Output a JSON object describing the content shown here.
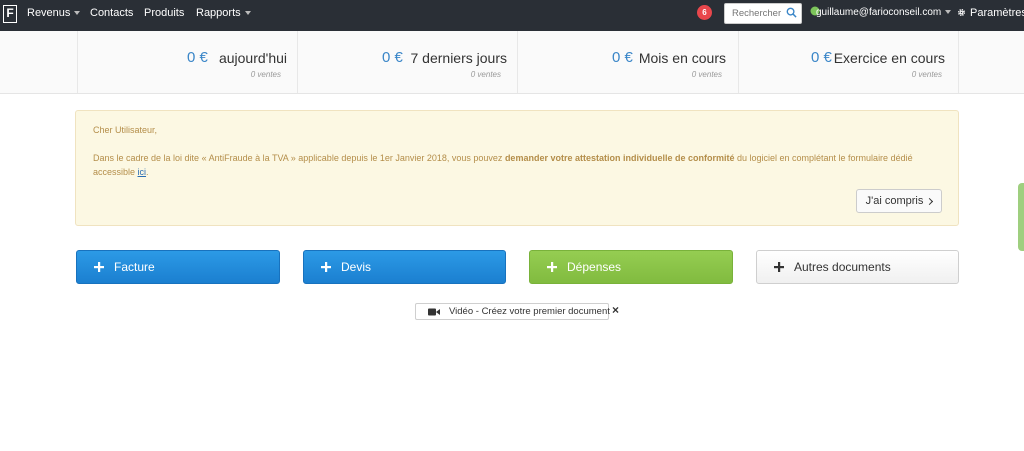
{
  "navbar": {
    "logo": "F",
    "menu": [
      {
        "label": "Revenus",
        "dropdown": true
      },
      {
        "label": "Contacts",
        "dropdown": false
      },
      {
        "label": "Produits",
        "dropdown": false
      },
      {
        "label": "Rapports",
        "dropdown": true
      }
    ],
    "notification_count": "6",
    "search_placeholder": "Rechercher",
    "user_email": "guillaume@farioconseil.com",
    "settings_label": "Paramètres"
  },
  "stats": [
    {
      "amount": "0 €",
      "label": "aujourd'hui",
      "sub": "0 ventes"
    },
    {
      "amount": "0 €",
      "label": "7 derniers jours",
      "sub": "0 ventes"
    },
    {
      "amount": "0 €",
      "label": "Mois en cours",
      "sub": "0 ventes"
    },
    {
      "amount": "0 €",
      "label": "Exercice en cours",
      "sub": "0 ventes"
    }
  ],
  "alert": {
    "greeting": "Cher Utilisateur,",
    "text_before": "Dans le cadre de la loi dite « AntiFraude à la TVA » applicable depuis le 1er Janvier 2018, vous pouvez ",
    "text_bold": "demander votre attestation individuelle de conformité",
    "text_after": " du logiciel en complétant le formulaire dédié accessible ",
    "link_text": "ici",
    "text_end": ".",
    "ack_label": "J'ai compris"
  },
  "actions": {
    "facture": "Facture",
    "devis": "Devis",
    "depenses": "Dépenses",
    "autres": "Autres documents"
  },
  "video": {
    "label": "Vidéo - Créez votre premier document",
    "close": "×"
  },
  "colors": {
    "navbar_bg": "#2a2f36",
    "accent_blue": "#1b7fd0",
    "accent_green": "#81bb3f",
    "amount_blue": "#3a86c8",
    "alert_bg": "#fcf8e3",
    "alert_text": "#b48e4a",
    "notification_red": "#e8474c"
  }
}
